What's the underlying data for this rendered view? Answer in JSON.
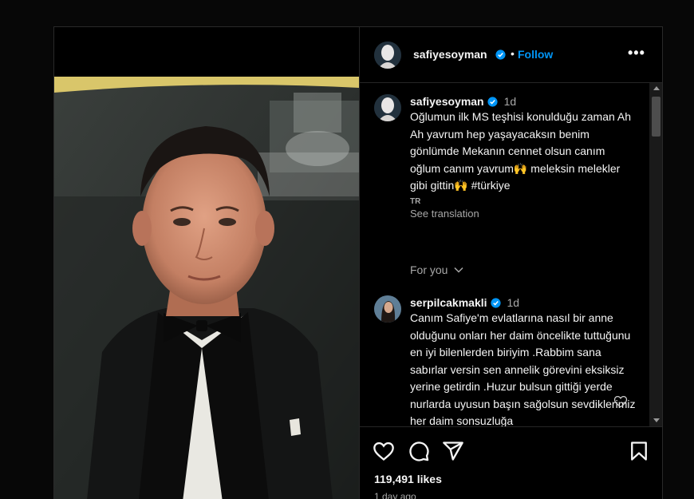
{
  "post": {
    "author": "safiyesoyman",
    "follow_label": "Follow",
    "separator": "•",
    "more_label": "•••"
  },
  "comments": [
    {
      "username": "safiyesoyman",
      "time": "1d",
      "text": "Oğlumun ilk MS teşhisi konulduğu zaman Ah Ah yavrum hep yaşayacaksın benim gönlümde Mekanın cennet olsun canım oğlum canım yavrum🙌 meleksin melekler gibi gittin🙌 #türkiye",
      "language": "TR",
      "see_translation": "See translation"
    },
    {
      "username": "serpilcakmakli",
      "time": "1d",
      "text": "Canım Safiye'm evlatlarına nasıl bir anne olduğunu onları her daim öncelikte tuttuğunu en iyi bilenlerden biriyim .Rabbim sana sabırlar versin sen annelik görevini eksiksiz yerine getirdin .Huzur bulsun gittiği yerde nurlarda uyusun başın sağolsun sevdiklerimiz her daim sonsuzluğa"
    }
  ],
  "for_you": "For you",
  "stats": {
    "likes": "119,491 likes",
    "ago": "1 day ago"
  },
  "icons": {
    "like": "heart-icon",
    "comment": "comment-icon",
    "share": "share-icon",
    "save": "bookmark-icon",
    "verified": "verified-badge-icon"
  },
  "colors": {
    "link": "#0095f6",
    "verified": "#0095f6",
    "muted": "#a8a8a8",
    "background": "#000000"
  }
}
